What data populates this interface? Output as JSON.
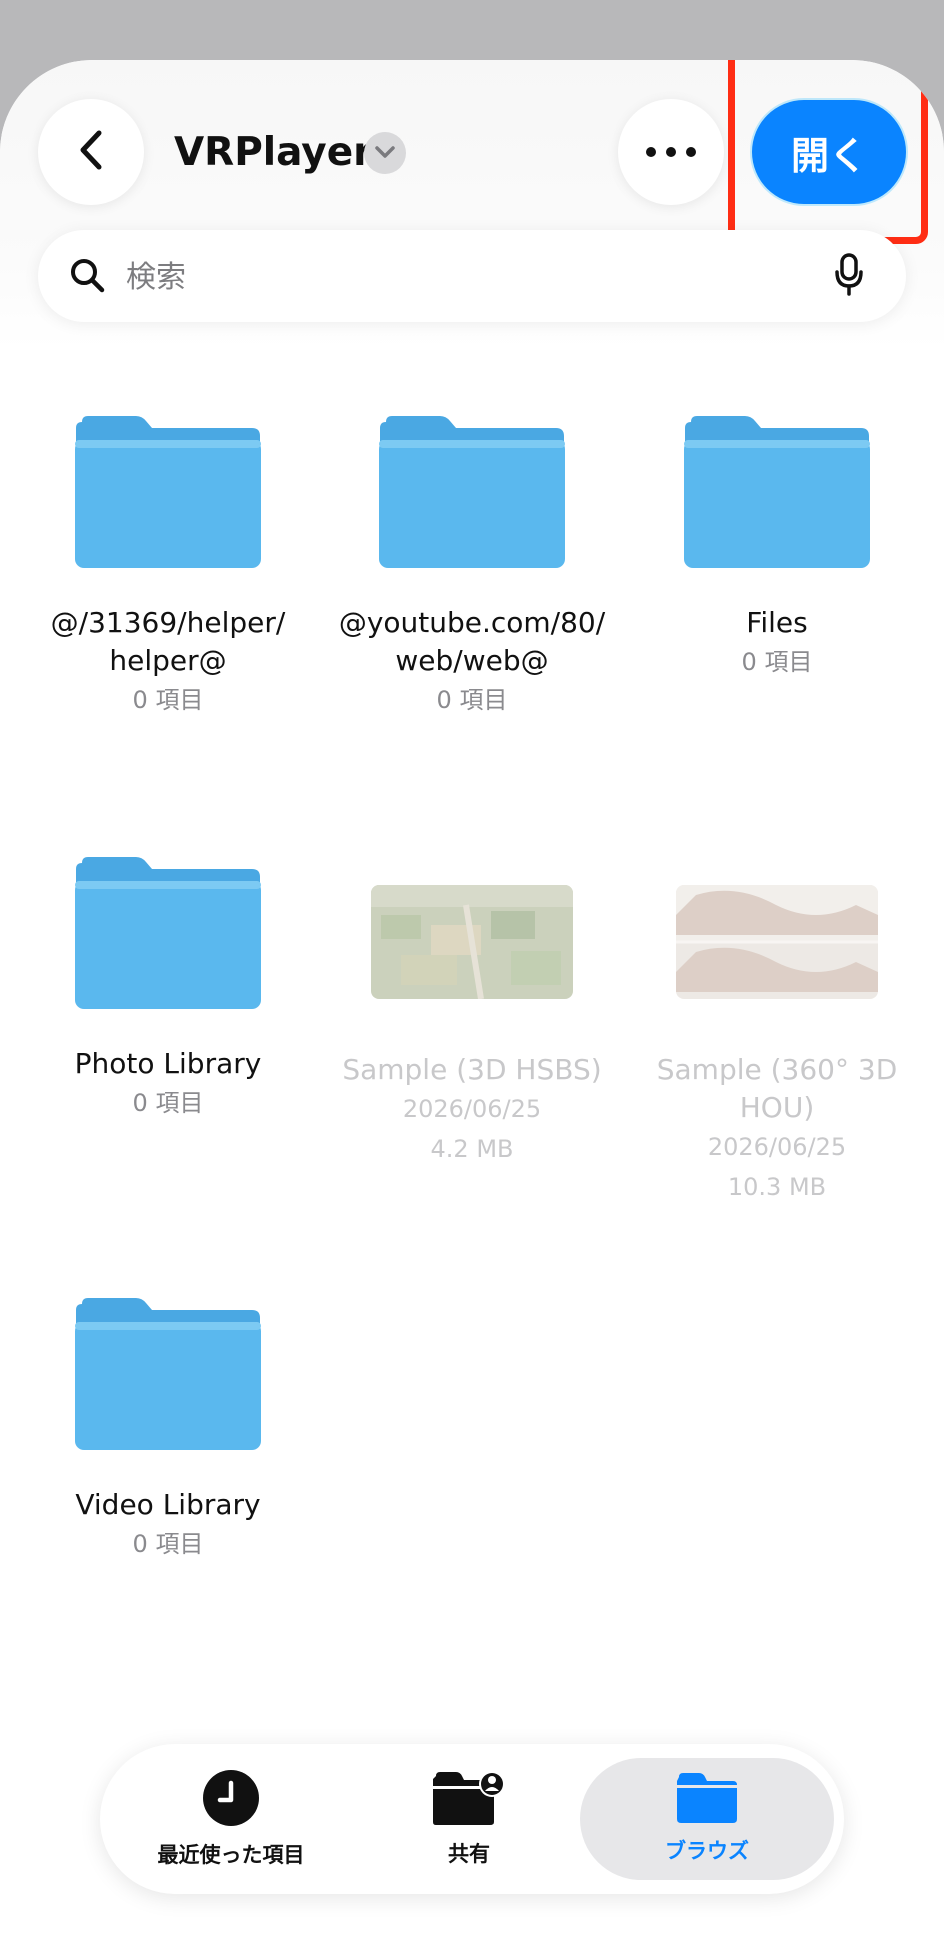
{
  "header": {
    "title": "VRPlayer",
    "open_label": "開く"
  },
  "search": {
    "placeholder": "検索"
  },
  "items": [
    {
      "name": "@/31369/helper/\nhelper@",
      "meta1": "0 項目",
      "meta2": ""
    },
    {
      "name": "@youtube.com/80/\nweb/web@",
      "meta1": "0 項目",
      "meta2": ""
    },
    {
      "name": "Files",
      "meta1": "0 項目",
      "meta2": ""
    },
    {
      "name": "Photo Library",
      "meta1": "0 項目",
      "meta2": ""
    },
    {
      "name": "Sample (3D HSBS)",
      "meta1": "2026/06/25",
      "meta2": "4.2 MB"
    },
    {
      "name": "Sample (360° 3D\nHOU)",
      "meta1": "2026/06/25",
      "meta2": "10.3 MB"
    },
    {
      "name": "Video Library",
      "meta1": "0 項目",
      "meta2": ""
    }
  ],
  "tabs": [
    {
      "label": "最近使った項目",
      "icon": "clock-icon"
    },
    {
      "label": "共有",
      "icon": "shared-folder-icon"
    },
    {
      "label": "ブラウズ",
      "icon": "folder-icon",
      "active": true
    }
  ],
  "colors": {
    "accent": "#0a84ff",
    "highlight": "#ff2d14",
    "folder": "#5ab8ee"
  }
}
